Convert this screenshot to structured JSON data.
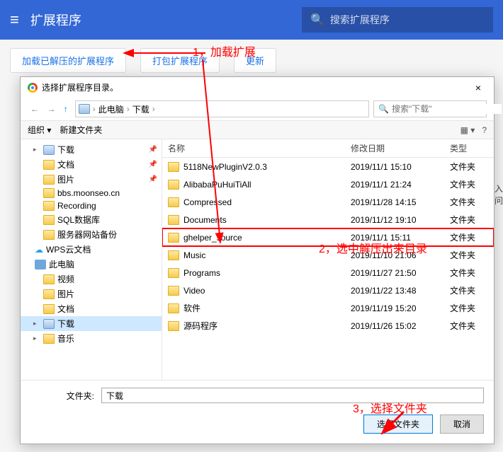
{
  "header": {
    "title": "扩展程序",
    "search_placeholder": "搜索扩展程序"
  },
  "toolbar": {
    "load_unpacked": "加载已解压的扩展程序",
    "pack": "打包扩展程序",
    "update": "更新"
  },
  "annotations": {
    "a1": "1，加载扩展",
    "a2": "2，选中解压出来目录",
    "a3": "3，选择文件夹"
  },
  "dialog": {
    "title": "选择扩展程序目录。",
    "close": "×",
    "nav": {
      "pc": "此电脑",
      "loc": "下载",
      "sep": "›",
      "search_placeholder": "搜索\"下载\""
    },
    "tools": {
      "org": "组织 ▾",
      "newf": "新建文件夹",
      "view": "▦ ▾",
      "help": "?"
    },
    "columns": {
      "name": "名称",
      "date": "修改日期",
      "type": "类型"
    },
    "tree": [
      {
        "tw": "▸",
        "icon": "disk",
        "label": "下载",
        "ind": "ind1",
        "pin": "📌"
      },
      {
        "tw": "",
        "icon": "fold-y",
        "label": "文档",
        "ind": "ind1",
        "pin": "📌"
      },
      {
        "tw": "",
        "icon": "fold-y",
        "label": "图片",
        "ind": "ind1",
        "pin": "📌"
      },
      {
        "tw": "",
        "icon": "fold-y",
        "label": "bbs.moonseo.cn",
        "ind": "ind1"
      },
      {
        "tw": "",
        "icon": "fold-y",
        "label": "Recording",
        "ind": "ind1"
      },
      {
        "tw": "",
        "icon": "fold-y",
        "label": "SQL数据库",
        "ind": "ind1"
      },
      {
        "tw": "",
        "icon": "fold-y",
        "label": "服务器网站备份",
        "ind": "ind1"
      },
      {
        "tw": "",
        "icon": "cloud",
        "label": "WPS云文档",
        "ind": "",
        "cloud": true
      },
      {
        "tw": "",
        "icon": "pc",
        "label": "此电脑",
        "ind": ""
      },
      {
        "tw": "",
        "icon": "fold-y",
        "label": "视频",
        "ind": "ind1"
      },
      {
        "tw": "",
        "icon": "fold-y",
        "label": "图片",
        "ind": "ind1"
      },
      {
        "tw": "",
        "icon": "fold-y",
        "label": "文档",
        "ind": "ind1"
      },
      {
        "tw": "▸",
        "icon": "disk",
        "label": "下载",
        "ind": "ind1",
        "sel": true
      },
      {
        "tw": "▸",
        "icon": "fold-y",
        "label": "音乐",
        "ind": "ind1"
      }
    ],
    "files": [
      {
        "name": "5118NewPluginV2.0.3",
        "date": "2019/11/1 15:10",
        "type": "文件夹"
      },
      {
        "name": "AlibabaPuHuiTiAll",
        "date": "2019/11/1 21:24",
        "type": "文件夹"
      },
      {
        "name": "Compressed",
        "date": "2019/11/28 14:15",
        "type": "文件夹"
      },
      {
        "name": "Documents",
        "date": "2019/11/12 19:10",
        "type": "文件夹"
      },
      {
        "name": "ghelper_source",
        "date": "2019/11/1 15:11",
        "type": "文件夹",
        "sel": true
      },
      {
        "name": "Music",
        "date": "2019/11/10 21:06",
        "type": "文件夹"
      },
      {
        "name": "Programs",
        "date": "2019/11/27 21:50",
        "type": "文件夹"
      },
      {
        "name": "Video",
        "date": "2019/11/22 13:48",
        "type": "文件夹"
      },
      {
        "name": "软件",
        "date": "2019/11/19 15:20",
        "type": "文件夹"
      },
      {
        "name": "源码程序",
        "date": "2019/11/26 15:02",
        "type": "文件夹"
      }
    ],
    "footer": {
      "label": "文件夹:",
      "value": "下载",
      "ok": "选择文件夹",
      "cancel": "取消"
    }
  },
  "side": {
    "l1": "入",
    "l2": "问"
  }
}
